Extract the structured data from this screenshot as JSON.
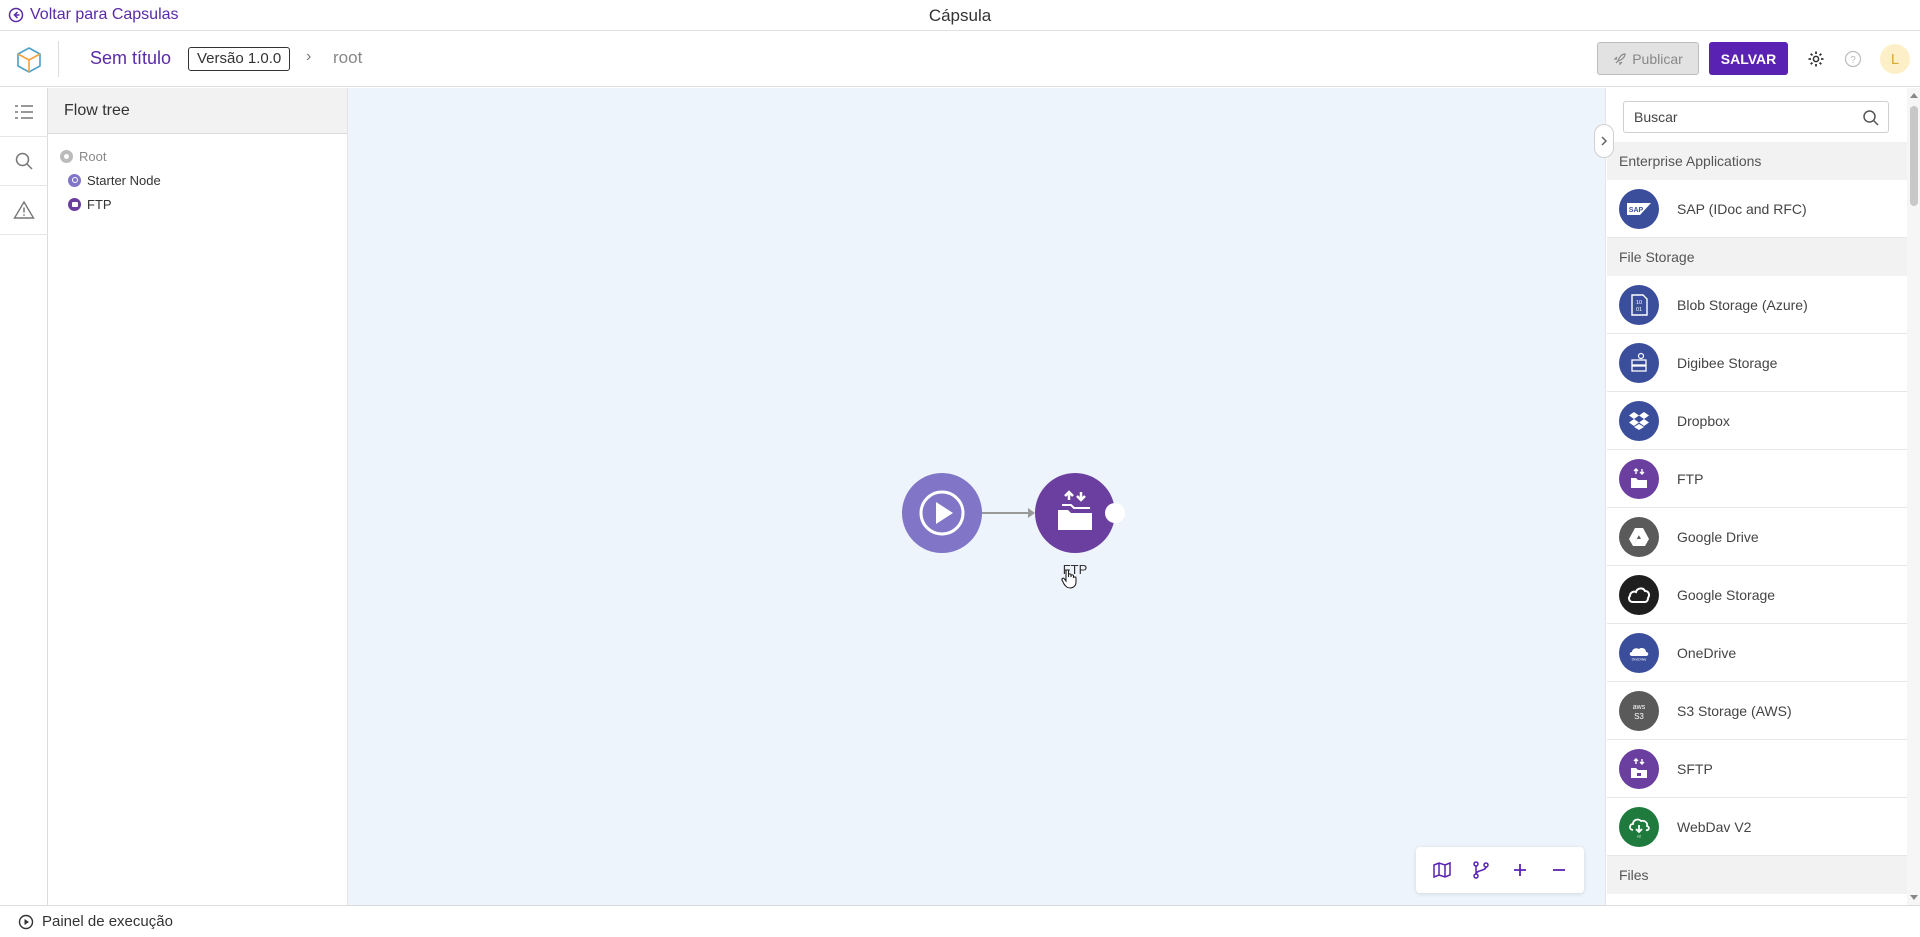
{
  "topbar": {
    "back_label": "Voltar para Capsulas",
    "window_title": "Cápsula"
  },
  "header": {
    "capsule_name": "Sem título",
    "version": "Versão 1.0.0",
    "breadcrumb_root": "root",
    "publish_label": "Publicar",
    "save_label": "SALVAR",
    "avatar_initial": "L"
  },
  "rail": {
    "items": [
      "flow-tree-icon",
      "search-icon",
      "warning-icon"
    ]
  },
  "flow_tree": {
    "title": "Flow tree",
    "root": "Root",
    "children": [
      "Starter Node",
      "FTP"
    ]
  },
  "canvas": {
    "nodes": [
      {
        "name": "start-node",
        "icon": "play-icon",
        "label": ""
      },
      {
        "name": "ftp-node",
        "icon": "folder-transfer-icon",
        "label": "FTP"
      }
    ]
  },
  "palette": {
    "search_placeholder": "Buscar",
    "categories": [
      {
        "title": "Enterprise Applications",
        "items": [
          {
            "label": "SAP (IDoc and RFC)",
            "color": "#3a4e9c"
          }
        ]
      },
      {
        "title": "File Storage",
        "items": [
          {
            "label": "Blob Storage (Azure)",
            "color": "#3a4e9c"
          },
          {
            "label": "Digibee Storage",
            "color": "#3a4e9c"
          },
          {
            "label": "Dropbox",
            "color": "#3a4e9c"
          },
          {
            "label": "FTP",
            "color": "#6b3fa0"
          },
          {
            "label": "Google Drive",
            "color": "#5a5a5a"
          },
          {
            "label": "Google Storage",
            "color": "#1f1f1f"
          },
          {
            "label": "OneDrive",
            "color": "#3a4e9c"
          },
          {
            "label": "S3 Storage (AWS)",
            "color": "#5a5a5a"
          },
          {
            "label": "SFTP",
            "color": "#6b3fa0"
          },
          {
            "label": "WebDav V2",
            "color": "#1f7a3e"
          }
        ]
      },
      {
        "title": "Files",
        "items": []
      }
    ]
  },
  "footer": {
    "label": "Painel de execução"
  },
  "colors": {
    "accent": "#5a22b2",
    "canvas_bg": "#eef4fc"
  }
}
